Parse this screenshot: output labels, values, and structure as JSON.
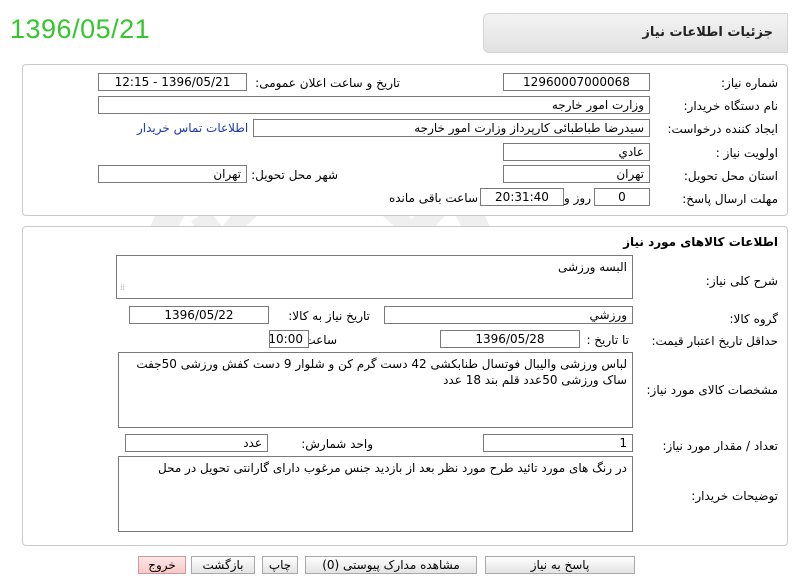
{
  "stamp_date": "1396/05/21",
  "page_title": "جزئیات اطلاعات نیاز",
  "header": {
    "need_number_label": "شماره نیاز:",
    "need_number": "12960007000068",
    "announce_label": "تاریخ و ساعت اعلان عمومی:",
    "announce_value": "1396/05/21 - 12:15",
    "buyer_org_label": "نام دستگاه خریدار:",
    "buyer_org": "وزارت امور خارجه",
    "creator_label": "ایجاد کننده درخواست:",
    "creator": "سیدرضا طباطبائی کارپرداز وزارت امور خارجه",
    "contact_link": "اطلاعات تماس خریدار",
    "priority_label": "اولویت نیاز :",
    "priority": "عادي",
    "province_label": "استان محل تحویل:",
    "province": "تهران",
    "city_label": "شهر محل تحویل:",
    "city": "تهران",
    "deadline_label": "مهلت ارسال پاسخ:",
    "days": "0",
    "days_label": "روز و",
    "time_left": "20:31:40",
    "remaining_label": "ساعت باقی مانده"
  },
  "goods": {
    "section_title": "اطلاعات کالاهای مورد نیاز",
    "summary_label": "شرح کلی نیاز:",
    "summary": "البسه ورزشی",
    "group_label": "گروه کالا:",
    "group": "ورزشي",
    "need_date_label": "تاریخ نیاز به کالا:",
    "need_date": "1396/05/22",
    "min_validity_label": "حداقل تاریخ اعتبار قیمت:",
    "until_date_label": "تا تاریخ :",
    "until_date": "1396/05/28",
    "time_label": "ساعت :",
    "time": "10:00",
    "specs_label": "مشخصات کالای مورد نیاز:",
    "specs": "لباس ورزشی والیبال فوتسال طنابکشی 42 دست گرم کن و شلوار 9 دست کفش ورزشی 50جفت ساک ورزشی 50عدد قلم بند 18 عدد",
    "qty_label": "تعداد / مقدار مورد نیاز:",
    "qty": "1",
    "unit_label": "واحد شمارش:",
    "unit": "عدد",
    "buyer_notes_label": "توضیحات خریدار:",
    "buyer_notes": "در رنگ های مورد تائید طرح مورد نظر بعد از بازدید جنس مرغوب دارای گارانتی تحویل در محل"
  },
  "buttons": {
    "reply": "پاسخ به نیاز",
    "attachments": "مشاهده مدارک پیوستی (0)",
    "print": "چاپ",
    "back": "بازگشت",
    "exit": "خروج"
  }
}
